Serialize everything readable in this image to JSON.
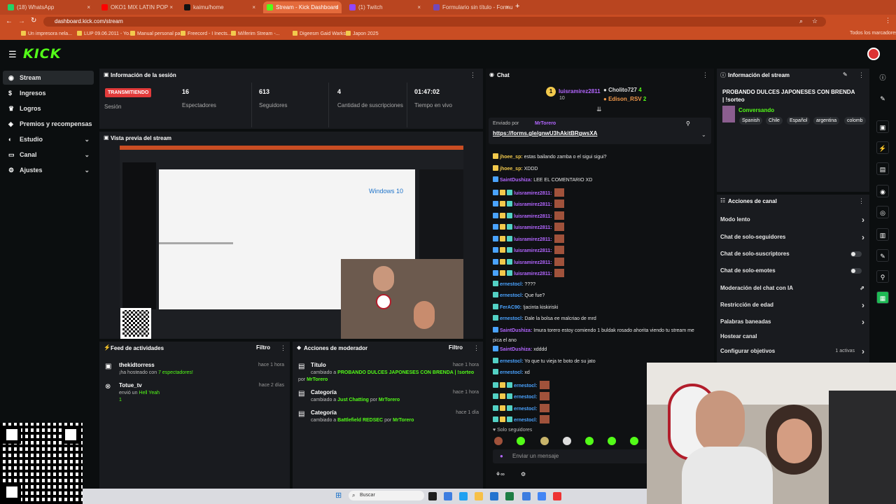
{
  "browser": {
    "tabs": [
      {
        "label": "(18) WhatsApp",
        "color": "#25d366"
      },
      {
        "label": "OKO1 MIX LATIN POP",
        "color": "#ff0000"
      },
      {
        "label": "kaimu/home",
        "color": "#111111"
      },
      {
        "label": "Stream - Kick Dashboard",
        "color": "#53fc18"
      },
      {
        "label": "(1) Twitch",
        "color": "#9146ff"
      },
      {
        "label": "Formulario sin título - Formul...",
        "color": "#7248b9"
      }
    ],
    "url": "dashboard.kick.com/stream",
    "bookmarks": [
      "Un impresora nela...",
      "LUP 09.06.2011 - Yo...",
      "Manual personal pa...",
      "Freecord - I Inects...",
      "M/iferim Stream -...",
      "Digeesm Gaid Warks...",
      "Japon 2025"
    ],
    "all_bookmarks": "Todos los marcadores"
  },
  "header": {
    "logo": "KICK"
  },
  "sidebar": {
    "items": [
      {
        "label": "Stream",
        "icon": "broadcast-icon"
      },
      {
        "label": "Ingresos",
        "icon": "money-icon"
      },
      {
        "label": "Logros",
        "icon": "trophy-icon"
      },
      {
        "label": "Premios y recompensas",
        "icon": "gift-icon"
      },
      {
        "label": "Estudio",
        "icon": "studio-icon"
      },
      {
        "label": "Canal",
        "icon": "channel-icon"
      },
      {
        "label": "Ajustes",
        "icon": "gear-icon"
      }
    ]
  },
  "session": {
    "title": "Información de la sesión",
    "live_badge": "TRANSMITIENDO",
    "session_label": "Sesión",
    "stats": [
      {
        "value": "16",
        "label": "Espectadores"
      },
      {
        "value": "613",
        "label": "Seguidores"
      },
      {
        "value": "4",
        "label": "Cantidad de suscripciones"
      },
      {
        "value": "01:47:02",
        "label": "Tiempo en vivo"
      }
    ]
  },
  "preview": {
    "title": "Vista previa del stream",
    "windows_label": "Windows 10"
  },
  "feed": {
    "title": "Feed de actividades",
    "filter": "Filtro",
    "items": [
      {
        "user": "thekidtorress",
        "text": "¡ha hosteado con",
        "extra": "7 espectadores!",
        "time": "hace 1 hora"
      },
      {
        "user": "Totue_tv",
        "text": "envió un",
        "extra": "Hell Yeah",
        "count": "1",
        "time": "hace 2 días"
      }
    ]
  },
  "mod": {
    "title": "Acciones de moderador",
    "filter": "Filtro",
    "items": [
      {
        "head": "Título",
        "text": "cambiado a",
        "value": "PROBANDO DULCES JAPONESES CON BRENDA | !sorteo",
        "by": "por",
        "user": "MrTorero",
        "time": "hace 1 hora"
      },
      {
        "head": "Categoría",
        "text": "cambiado a",
        "value": "Just Chatting",
        "by": "por",
        "user": "MrTorero",
        "time": "hace 1 hora"
      },
      {
        "head": "Categoría",
        "text": "cambiado a",
        "value": "Battlefield REDSEC",
        "by": "por",
        "user": "MrTorero",
        "time": "hace 1 día"
      }
    ]
  },
  "chat": {
    "title": "Chat",
    "top_gifters": [
      {
        "name": "luisramirez2811",
        "count": "10"
      },
      {
        "name": "Cholito727",
        "count": "4"
      },
      {
        "name": "Edison_RSV",
        "count": "2"
      }
    ],
    "pinned_by_label": "Enviado por",
    "pinned_user": "MrTorero",
    "pinned_link": "https://forms.gle/gnwU3hAkitBRgwsXA",
    "messages": [
      {
        "user": "jhoee_sp:",
        "text": "estas bailando zamba o el sigui sigui?",
        "color": "#f2c94c"
      },
      {
        "user": "jhoee_sp:",
        "text": "XDDD",
        "color": "#f2c94c"
      },
      {
        "user": "SaintDushiza:",
        "text": "LEE EL COMENTARIO XD",
        "color": "#b366ff"
      },
      {
        "user": "luisramirez2811:",
        "text": "",
        "color": "#b366ff",
        "emote": true
      },
      {
        "user": "luisramirez2811:",
        "text": "",
        "color": "#b366ff",
        "emote": true
      },
      {
        "user": "luisramirez2811:",
        "text": "",
        "color": "#b366ff",
        "emote": true
      },
      {
        "user": "luisramirez2811:",
        "text": "",
        "color": "#b366ff",
        "emote": true
      },
      {
        "user": "luisramirez2811:",
        "text": "",
        "color": "#b366ff",
        "emote": true
      },
      {
        "user": "luisramirez2811:",
        "text": "",
        "color": "#b366ff",
        "emote": true
      },
      {
        "user": "luisramirez2811:",
        "text": "",
        "color": "#b366ff",
        "emote": true
      },
      {
        "user": "luisramirez2811:",
        "text": "",
        "color": "#b366ff",
        "emote": true
      },
      {
        "user": "ernestocl:",
        "text": "????",
        "color": "#4aa3ff"
      },
      {
        "user": "ernestocl:",
        "text": "Que fue?",
        "color": "#4aa3ff"
      },
      {
        "user": "FerAC90:",
        "text": "!jacinta kiskiriski",
        "color": "#4aa3ff"
      },
      {
        "user": "ernestocl:",
        "text": "Dale la bolsa ee malcriao de mrd",
        "color": "#4aa3ff"
      },
      {
        "user": "SaintDushiza:",
        "text": "Imura torero estoy comiendo 1 buldak rosado ahorita viendo tu stream me",
        "color": "#b366ff"
      },
      {
        "user": "",
        "text": "pica el ano",
        "color": "#b366ff"
      },
      {
        "user": "SaintDushiza:",
        "text": "xdddd",
        "color": "#b366ff"
      },
      {
        "user": "ernestocl:",
        "text": "Yo que tu vieja te boto de su jato",
        "color": "#4aa3ff"
      },
      {
        "user": "ernestocl:",
        "text": "xd",
        "color": "#4aa3ff"
      },
      {
        "user": "ernestocl:",
        "text": "",
        "color": "#4aa3ff",
        "emote": true
      },
      {
        "user": "ernestocl:",
        "text": "",
        "color": "#4aa3ff",
        "emote": true
      },
      {
        "user": "ernestocl:",
        "text": "",
        "color": "#4aa3ff",
        "emote": true
      },
      {
        "user": "ernestocl:",
        "text": "",
        "color": "#4aa3ff",
        "emote": true
      }
    ],
    "followers_only": "Solo seguidores",
    "input_placeholder": "Enviar un mensaje"
  },
  "stream_info": {
    "title": "Información del stream",
    "stream_title": "PROBANDO DULCES JAPONESES CON BRENDA | !sorteo",
    "category": "Conversando",
    "tags": [
      "Spanish",
      "Chile",
      "Español",
      "argentina",
      "colomb"
    ]
  },
  "channel_actions": {
    "title": "Acciones de canal",
    "items": [
      {
        "label": "Modo lento",
        "kind": "arrow"
      },
      {
        "label": "Chat de solo-seguidores",
        "kind": "arrow"
      },
      {
        "label": "Chat de solo-suscriptores",
        "kind": "toggle"
      },
      {
        "label": "Chat de solo-emotes",
        "kind": "toggle"
      },
      {
        "label": "Moderación del chat con IA",
        "kind": "external"
      },
      {
        "label": "Restricción de edad",
        "kind": "arrow"
      },
      {
        "label": "Palabras baneadas",
        "kind": "arrow"
      },
      {
        "label": "Hostear canal",
        "kind": "none"
      },
      {
        "label": "Configurar objetivos",
        "kind": "arrow",
        "extra": "1 activas"
      }
    ]
  },
  "taskbar": {
    "search": "Buscar"
  }
}
